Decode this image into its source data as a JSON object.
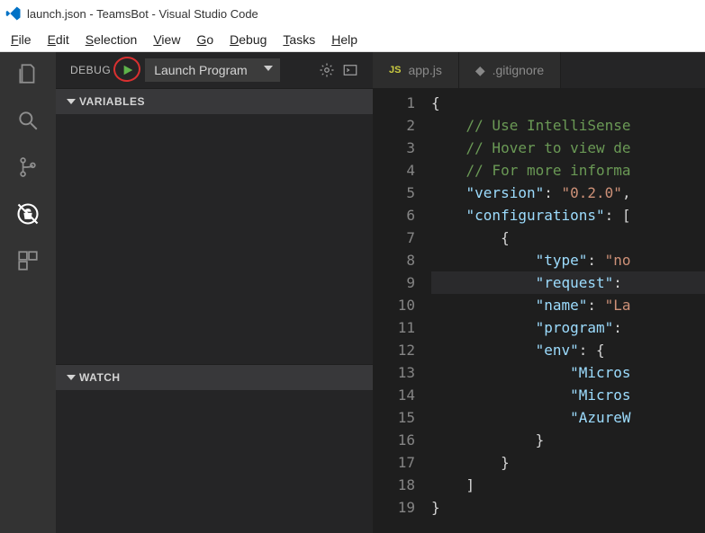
{
  "titlebar": {
    "title": "launch.json - TeamsBot - Visual Studio Code"
  },
  "menubar": {
    "file": "File",
    "edit": "Edit",
    "selection": "Selection",
    "view": "View",
    "go": "Go",
    "debug": "Debug",
    "tasks": "Tasks",
    "help": "Help"
  },
  "sidebar": {
    "debug_label": "DEBUG",
    "config_selected": "Launch Program",
    "sections": {
      "variables": "VARIABLES",
      "watch": "WATCH"
    }
  },
  "tabs": {
    "appjs": "app.js",
    "gitignore": ".gitignore"
  },
  "editor": {
    "lines": [
      {
        "n": 1,
        "tokens": [
          [
            "br",
            "{"
          ]
        ]
      },
      {
        "n": 2,
        "tokens": [
          [
            "pad",
            "    "
          ],
          [
            "cm",
            "// Use IntelliSense"
          ]
        ]
      },
      {
        "n": 3,
        "tokens": [
          [
            "pad",
            "    "
          ],
          [
            "cm",
            "// Hover to view de"
          ]
        ]
      },
      {
        "n": 4,
        "tokens": [
          [
            "pad",
            "    "
          ],
          [
            "cm",
            "// For more informa"
          ]
        ]
      },
      {
        "n": 5,
        "tokens": [
          [
            "pad",
            "    "
          ],
          [
            "key",
            "\"version\""
          ],
          [
            "pn",
            ": "
          ],
          [
            "str",
            "\"0.2.0\""
          ],
          [
            "pn",
            ","
          ]
        ]
      },
      {
        "n": 6,
        "tokens": [
          [
            "pad",
            "    "
          ],
          [
            "key",
            "\"configurations\""
          ],
          [
            "pn",
            ": "
          ],
          [
            "br",
            "["
          ]
        ]
      },
      {
        "n": 7,
        "tokens": [
          [
            "pad",
            "        "
          ],
          [
            "br",
            "{"
          ]
        ]
      },
      {
        "n": 8,
        "tokens": [
          [
            "pad",
            "            "
          ],
          [
            "key",
            "\"type\""
          ],
          [
            "pn",
            ": "
          ],
          [
            "str",
            "\"no"
          ]
        ]
      },
      {
        "n": 9,
        "hl": true,
        "tokens": [
          [
            "pad",
            "            "
          ],
          [
            "key",
            "\"request\""
          ],
          [
            "pn",
            ": "
          ]
        ]
      },
      {
        "n": 10,
        "tokens": [
          [
            "pad",
            "            "
          ],
          [
            "key",
            "\"name\""
          ],
          [
            "pn",
            ": "
          ],
          [
            "str",
            "\"La"
          ]
        ]
      },
      {
        "n": 11,
        "tokens": [
          [
            "pad",
            "            "
          ],
          [
            "key",
            "\"program\""
          ],
          [
            "pn",
            ": "
          ]
        ]
      },
      {
        "n": 12,
        "tokens": [
          [
            "pad",
            "            "
          ],
          [
            "key",
            "\"env\""
          ],
          [
            "pn",
            ": "
          ],
          [
            "br",
            "{"
          ]
        ]
      },
      {
        "n": 13,
        "tokens": [
          [
            "pad",
            "                "
          ],
          [
            "key",
            "\"Micros"
          ]
        ]
      },
      {
        "n": 14,
        "tokens": [
          [
            "pad",
            "                "
          ],
          [
            "key",
            "\"Micros"
          ]
        ]
      },
      {
        "n": 15,
        "tokens": [
          [
            "pad",
            "                "
          ],
          [
            "key",
            "\"AzureW"
          ]
        ]
      },
      {
        "n": 16,
        "tokens": [
          [
            "pad",
            "            "
          ],
          [
            "br",
            "}"
          ]
        ]
      },
      {
        "n": 17,
        "tokens": [
          [
            "pad",
            "        "
          ],
          [
            "br",
            "}"
          ]
        ]
      },
      {
        "n": 18,
        "tokens": [
          [
            "pad",
            "    "
          ],
          [
            "br",
            "]"
          ]
        ]
      },
      {
        "n": 19,
        "tokens": [
          [
            "br",
            "}"
          ]
        ]
      }
    ]
  }
}
